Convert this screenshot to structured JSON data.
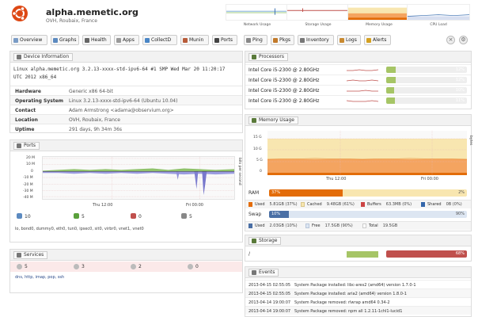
{
  "header": {
    "hostname": "alpha.memetic.org",
    "location": "OVH, Roubaix, France",
    "mini_graphs": [
      "Network Usage",
      "Storage Usage",
      "Memory Usage",
      "CPU Load"
    ]
  },
  "nav": {
    "tabs": [
      "Overview",
      "Graphs",
      "Health",
      "Apps",
      "CollectD",
      "Munin",
      "Ports",
      "Ping",
      "Pkgs",
      "Inventory",
      "Logs",
      "Alerts"
    ]
  },
  "device_info": {
    "title": "Device Information",
    "uname": "Linux alpha.memetic.org 3.2.13-xxxx-std-ipv6-64 #1 SMP Wed Mar 20 11:20:17 UTC 2012 x86_64",
    "rows": [
      {
        "k": "Hardware",
        "v": "Generic x86 64-bit"
      },
      {
        "k": "Operating System",
        "v": "Linux 3.2.13-xxxx-std-ipv6-64 (Ubuntu 10.04)"
      },
      {
        "k": "Contact",
        "v": "Adam Armstrong <adama@observium.org>"
      },
      {
        "k": "Location",
        "v": "OVH, Roubaix, France"
      },
      {
        "k": "Uptime",
        "v": "291 days, 9h 34m 36s"
      }
    ]
  },
  "ports": {
    "title": "Ports",
    "y_ticks": [
      "20 M",
      "10 M",
      "0",
      "-10 M",
      "-20 M",
      "-30 M",
      "-40 M"
    ],
    "x_ticks": [
      "Thu 12:00",
      "Fri 00:00"
    ],
    "side_label": "bits per second",
    "counts": [
      "10",
      "5",
      "0",
      "5"
    ],
    "list": "lo, bond0, dummy0, eth0, tun0, ipsec0, sit0, virbr0, vnet1, vnet0"
  },
  "services": {
    "title": "Services",
    "counts": [
      "5",
      "3",
      "2",
      "0"
    ],
    "list": "dns, http, imap, pop, ssh"
  },
  "processors": {
    "title": "Processors",
    "rows": [
      {
        "name": "Intel Core i5-2300 @ 2.80GHz",
        "pct": "12%",
        "val": 12
      },
      {
        "name": "Intel Core i5-2300 @ 2.80GHz",
        "pct": "12%",
        "val": 12
      },
      {
        "name": "Intel Core i5-2300 @ 2.80GHz",
        "pct": "10%",
        "val": 10
      },
      {
        "name": "Intel Core i5-2300 @ 2.80GHz",
        "pct": "11%",
        "val": 11
      }
    ]
  },
  "memory": {
    "title": "Memory Usage",
    "y_ticks": [
      "15 G",
      "10 G",
      "5 G",
      "0"
    ],
    "x_ticks": [
      "Thu 12:00",
      "Fri 00:00"
    ],
    "side_label": "bytes",
    "ram": {
      "label": "RAM",
      "used_pct": "37%",
      "used_val": 37,
      "free_pct": "2%"
    },
    "ram_legend": [
      {
        "name": "Used",
        "val": "5.81GB (37%)",
        "color": "#e36c09"
      },
      {
        "name": "Cached",
        "val": "9.48GB (61%)",
        "color": "#f8e6b0"
      },
      {
        "name": "Buffers",
        "val": "63.3MB (0%)",
        "color": "#cc4444"
      },
      {
        "name": "Shared",
        "val": "0B (0%)",
        "color": "#3366aa"
      }
    ],
    "swap": {
      "label": "Swap",
      "used_pct": "10%",
      "used_val": 10,
      "free_pct": "90%"
    },
    "swap_legend": [
      {
        "name": "Used",
        "val": "2.03GB (10%)",
        "color": "#4a6fa5"
      },
      {
        "name": "Free",
        "val": "17.5GB (90%)",
        "color": "#dde6f2"
      },
      {
        "name": "Total",
        "val": "19.5GB",
        "color": "#ffffff"
      }
    ]
  },
  "storage": {
    "title": "Storage",
    "rows": [
      {
        "mount": "/",
        "pct": "68%",
        "val": 68
      }
    ]
  },
  "events": {
    "title": "Events",
    "rows": [
      {
        "time": "2013-04-15 02:55:05",
        "msg": "System Package installed: libc-ares2 (amd64) version 1.7.0-1"
      },
      {
        "time": "2013-04-15 02:55:05",
        "msg": "System Package installed: aria2 (amd64) version 1.8.0-1"
      },
      {
        "time": "2013-04-14 19:00:07",
        "msg": "System Package removed: rlwrap amd64 0.34-2"
      },
      {
        "time": "2013-04-14 19:00:07",
        "msg": "System Package removed: npm all 1.2.11-1chl1-lucid1"
      }
    ]
  },
  "colors": {
    "accent_orange": "#e36c09",
    "cpu_green": "#a6c566",
    "storage_red": "#c0504d",
    "swap_blue": "#4a6fa5",
    "mem_cached": "#f8e6b0"
  }
}
